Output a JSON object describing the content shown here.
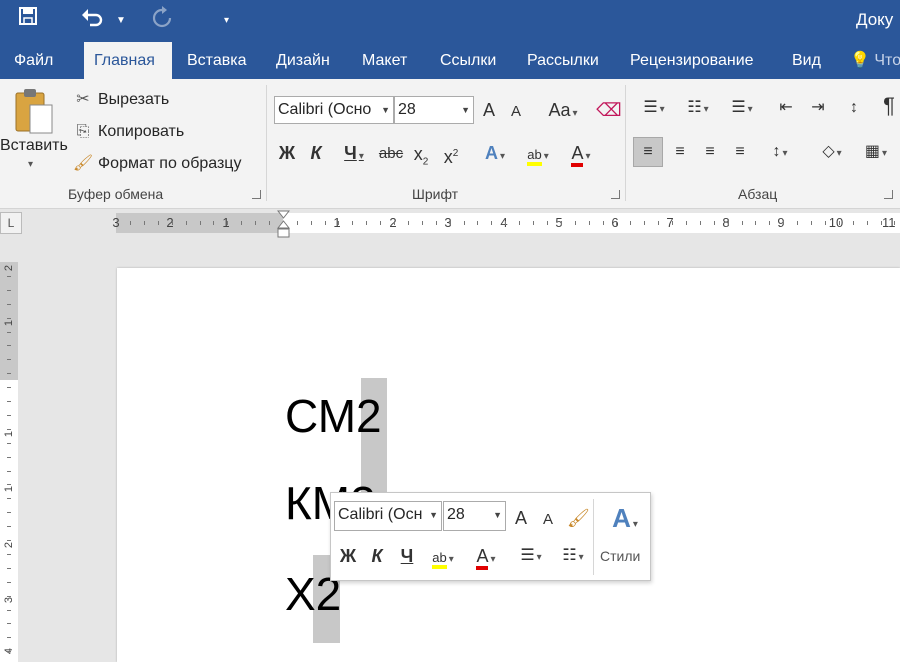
{
  "titlebar": {
    "save_icon": "save-icon",
    "undo_icon": "undo-icon",
    "redo_icon": "redo-icon",
    "customize_icon": "customize-quick-access-icon",
    "document_title": "Доку"
  },
  "tabs": [
    {
      "label": "Файл",
      "active": false
    },
    {
      "label": "Главная",
      "active": true
    },
    {
      "label": "Вставка",
      "active": false
    },
    {
      "label": "Дизайн",
      "active": false
    },
    {
      "label": "Макет",
      "active": false
    },
    {
      "label": "Ссылки",
      "active": false
    },
    {
      "label": "Рассылки",
      "active": false
    },
    {
      "label": "Рецензирование",
      "active": false
    },
    {
      "label": "Вид",
      "active": false
    }
  ],
  "tell_me": "Что",
  "clipboard": {
    "paste_label": "Вставить",
    "cut_label": "Вырезать",
    "copy_label": "Копировать",
    "format_painter_label": "Формат по образцу",
    "group_label": "Буфер обмена"
  },
  "font": {
    "font_name": "Calibri (Осно",
    "font_size": "28",
    "group_label": "Шрифт",
    "bold": "Ж",
    "italic": "К",
    "underline": "Ч",
    "strike": "abc",
    "subscript": "x",
    "subscript_mark": "2",
    "superscript": "x",
    "superscript_mark": "2",
    "grow": "A",
    "shrink": "A",
    "change_case": "Aa",
    "effects": "A",
    "highlight": "ab",
    "font_color": "A"
  },
  "paragraph": {
    "group_label": "Абзац",
    "pilcrow": "¶"
  },
  "ruler": {
    "corner": "L",
    "numbers": [
      "3",
      "2",
      "1",
      "1",
      "2",
      "3",
      "4",
      "5",
      "6",
      "7",
      "8",
      "9",
      "10",
      "11"
    ],
    "vertical_numbers": [
      "2",
      "1",
      "1",
      "1",
      "2",
      "3",
      "4"
    ]
  },
  "document": {
    "lines": [
      "СМ2",
      "КМ2",
      "Х2"
    ]
  },
  "mini_toolbar": {
    "font_name": "Calibri (Осн",
    "font_size": "28",
    "grow": "A",
    "shrink": "A",
    "bold": "Ж",
    "italic": "К",
    "underline": "Ч",
    "highlight": "ab",
    "font_color": "A",
    "styles_label": "Стили"
  },
  "colors": {
    "accent": "#2b579a",
    "ribbon_bg": "#f3f3f3",
    "highlight_yellow": "#ffff00",
    "font_red": "#e00000",
    "selection_gray": "#c8c8c8"
  }
}
